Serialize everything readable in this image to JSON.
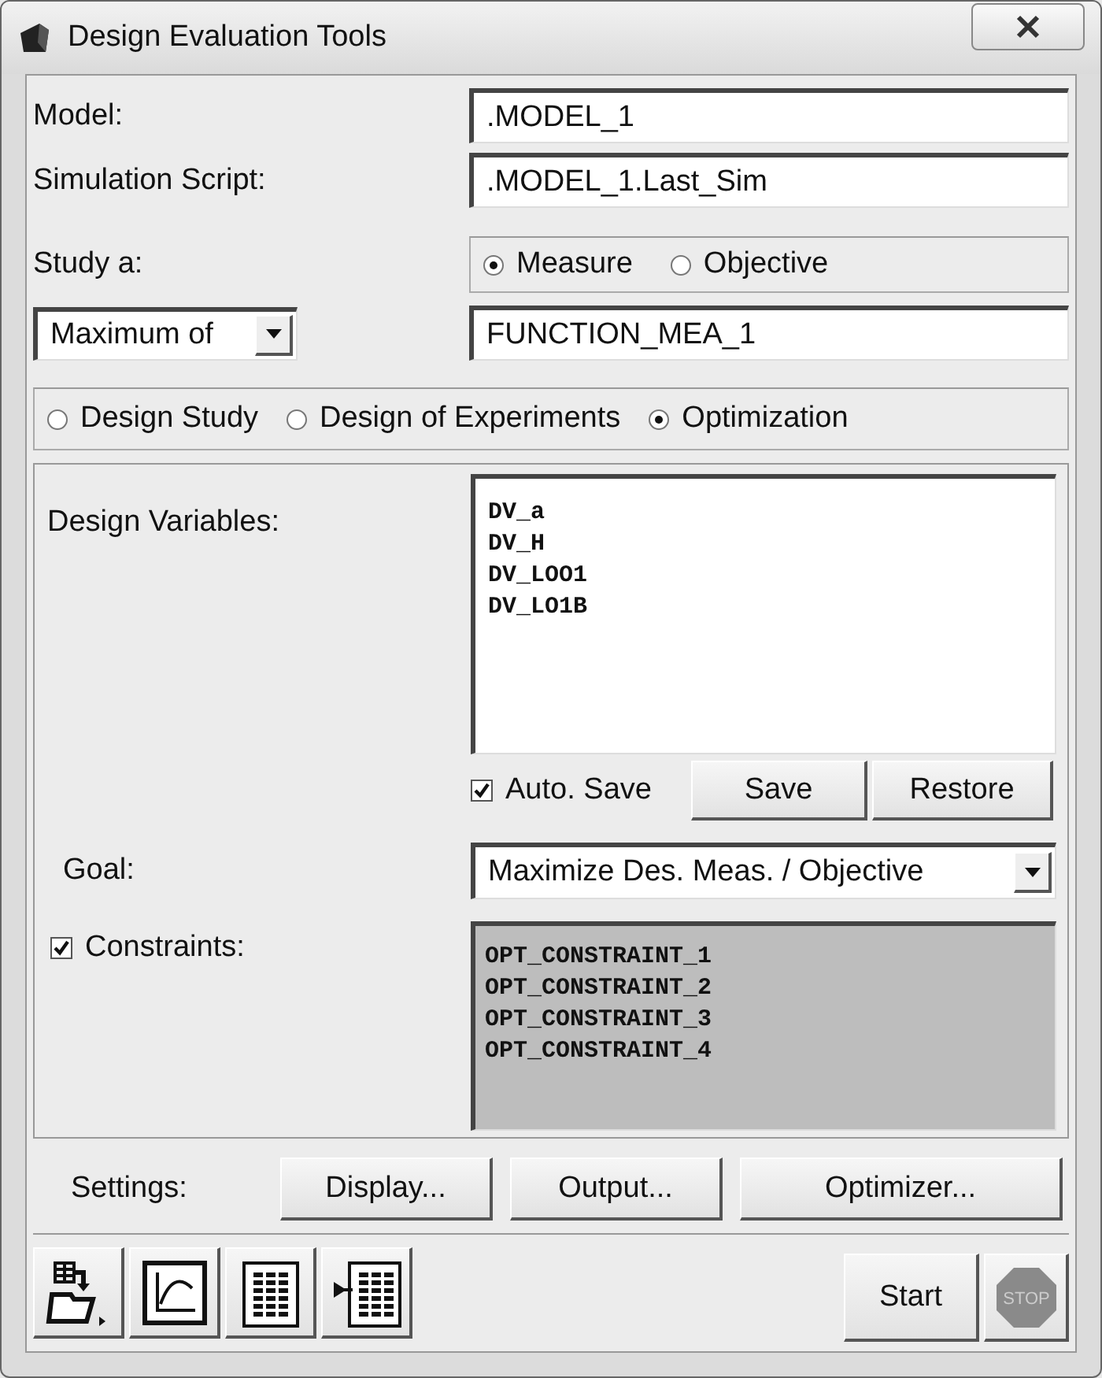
{
  "window": {
    "title": "Design Evaluation Tools"
  },
  "model": {
    "label": "Model:",
    "value": ".MODEL_1"
  },
  "simulation_script": {
    "label": "Simulation Script:",
    "value": ".MODEL_1.Last_Sim"
  },
  "study": {
    "label": "Study a:",
    "options": [
      {
        "label": "Measure",
        "selected": true
      },
      {
        "label": "Objective",
        "selected": false
      }
    ],
    "dropdown": {
      "value": "Maximum of"
    },
    "field": {
      "value": "FUNCTION_MEA_1"
    }
  },
  "study_type": [
    {
      "label": "Design Study",
      "selected": false
    },
    {
      "label": "Design of Experiments",
      "selected": false
    },
    {
      "label": "Optimization",
      "selected": true
    }
  ],
  "design_variables": {
    "label": "Design Variables:",
    "items": [
      "DV_a",
      "DV_H",
      "DV_LOO1",
      "DV_LO1B"
    ]
  },
  "auto_save": {
    "label": "Auto. Save",
    "checked": true
  },
  "list_buttons": [
    "Save",
    "Restore"
  ],
  "goal": {
    "label": "Goal:",
    "value": "Maximize Des. Meas. / Objective"
  },
  "constraints": {
    "label": "Constraints:",
    "checked": true,
    "items": [
      "OPT_CONSTRAINT_1",
      "OPT_CONSTRAINT_2",
      "OPT_CONSTRAINT_3",
      "OPT_CONSTRAINT_4"
    ]
  },
  "settings": {
    "label": "Settings:",
    "buttons": [
      "Display...",
      "Output...",
      "Optimizer..."
    ]
  },
  "start": "Start",
  "stop": "STOP"
}
